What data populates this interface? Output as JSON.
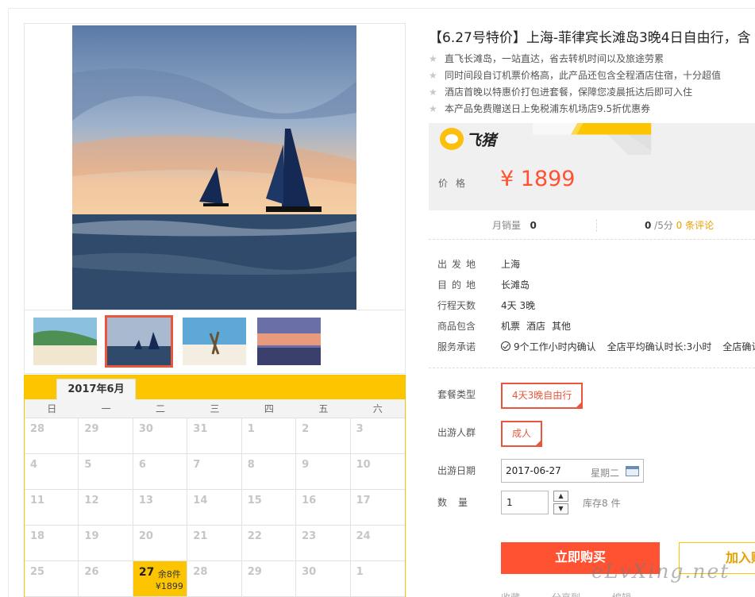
{
  "product": {
    "title": "【6.27号特价】上海-菲律宾长滩岛3晚4日自由行，含",
    "features": [
      "直飞长滩岛，一站直达，省去转机时间以及旅途劳累",
      "同时间段自订机票价格高，此产品还包含全程酒店住宿，十分超值",
      "酒店首晚以特惠价打包进套餐，保障您凌晨抵达后即可入住",
      "本产品免费赠送日上免税浦东机场店9.5折优惠券"
    ]
  },
  "brand": {
    "name": "飞猪"
  },
  "price": {
    "label": "价格",
    "value": "¥ 1899"
  },
  "stats": {
    "sales_label": "月销量",
    "sales_value": "0",
    "score_value": "0",
    "score_suffix": " /5分 ",
    "reviews": "0 条评论"
  },
  "props": [
    {
      "key": "出发地",
      "value": [
        "上海"
      ]
    },
    {
      "key": "目的地",
      "value": [
        "长滩岛"
      ]
    },
    {
      "key": "行程天数",
      "value": [
        "4天 3晚"
      ]
    },
    {
      "key": "商品包含",
      "value": [
        "机票",
        "酒店",
        "其他"
      ]
    },
    {
      "key": "服务承诺",
      "value": [
        "9个工作小时内确认",
        "全店平均确认时长:3小时",
        "全店确认"
      ]
    }
  ],
  "options": {
    "package_label": "套餐类型",
    "package_value": "4天3晚自由行",
    "people_label": "出游人群",
    "people_value": "成人",
    "date_label": "出游日期",
    "date_value": "2017-06-27",
    "date_weekday": "星期二",
    "qty_label": "数量",
    "qty_value": "1",
    "stock_note": "库存8 件"
  },
  "actions": {
    "buy": "立即购买",
    "cart": "加入购"
  },
  "watermark": "eLvXing.net",
  "bottom_links": [
    "收藏",
    "分享到",
    "编辑"
  ],
  "calendar": {
    "month": "2017年6月",
    "weekdays": [
      "日",
      "一",
      "二",
      "三",
      "四",
      "五",
      "六"
    ],
    "rows": [
      [
        "28",
        "29",
        "30",
        "31",
        "1",
        "2",
        "3"
      ],
      [
        "4",
        "5",
        "6",
        "7",
        "8",
        "9",
        "10"
      ],
      [
        "11",
        "12",
        "13",
        "14",
        "15",
        "16",
        "17"
      ],
      [
        "18",
        "19",
        "20",
        "21",
        "22",
        "23",
        "24"
      ],
      [
        "25",
        "26",
        "27",
        "28",
        "29",
        "30",
        "1"
      ]
    ],
    "active_day": {
      "row": 4,
      "col": 2,
      "stock": "余8件",
      "price": "¥1899"
    }
  },
  "colors": {
    "accent": "#ff5232",
    "brand_yellow": "#fdc500",
    "warn": "#e8a000"
  }
}
